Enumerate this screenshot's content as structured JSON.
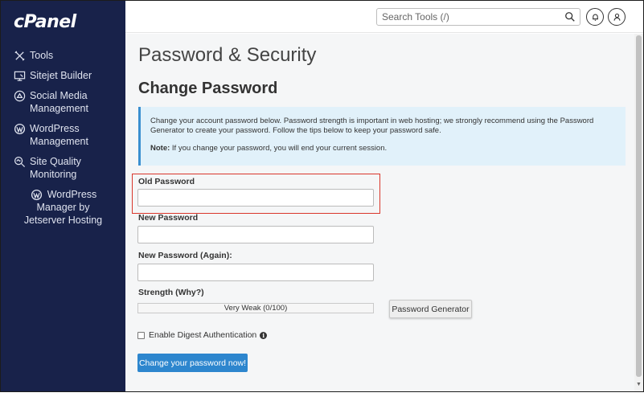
{
  "brand": {
    "logo": "cPanel"
  },
  "sidebar": {
    "items": [
      {
        "icon": "tools-icon",
        "label": "Tools"
      },
      {
        "icon": "sitejet-icon",
        "label": "Sitejet Builder"
      },
      {
        "icon": "social-media-icon",
        "label": "Social Media",
        "label2": "Management"
      },
      {
        "icon": "wordpress-icon",
        "label": "WordPress",
        "label2": "Management"
      },
      {
        "icon": "site-quality-icon",
        "label": "Site Quality",
        "label2": "Monitoring"
      },
      {
        "icon": "wordpress-icon",
        "label": "WordPress",
        "label2": "Manager by",
        "label3": "Jetserver Hosting"
      }
    ]
  },
  "header": {
    "search_placeholder": "Search Tools (/)"
  },
  "main": {
    "page_title": "Password & Security",
    "section_title": "Change Password",
    "info_text": "Change your account password below. Password strength is important in web hosting; we strongly recommend using the Password Generator to create your password. Follow the tips below to keep your password safe.",
    "note_label": "Note:",
    "note_text": " If you change your password, you will end your current session.",
    "old_password_label": "Old Password",
    "new_password_label": "New Password",
    "new_password_again_label": "New Password (Again):",
    "strength_label": "Strength (Why?)",
    "strength_value": "Very Weak (0/100)",
    "generator_button": "Password Generator",
    "digest_label": "Enable Digest Authentication",
    "submit_button": "Change your password now!"
  },
  "colors": {
    "sidebar_bg": "#18224a",
    "accent": "#2d86ce",
    "info_bg": "#e1f1fa",
    "highlight": "#d9362b"
  }
}
